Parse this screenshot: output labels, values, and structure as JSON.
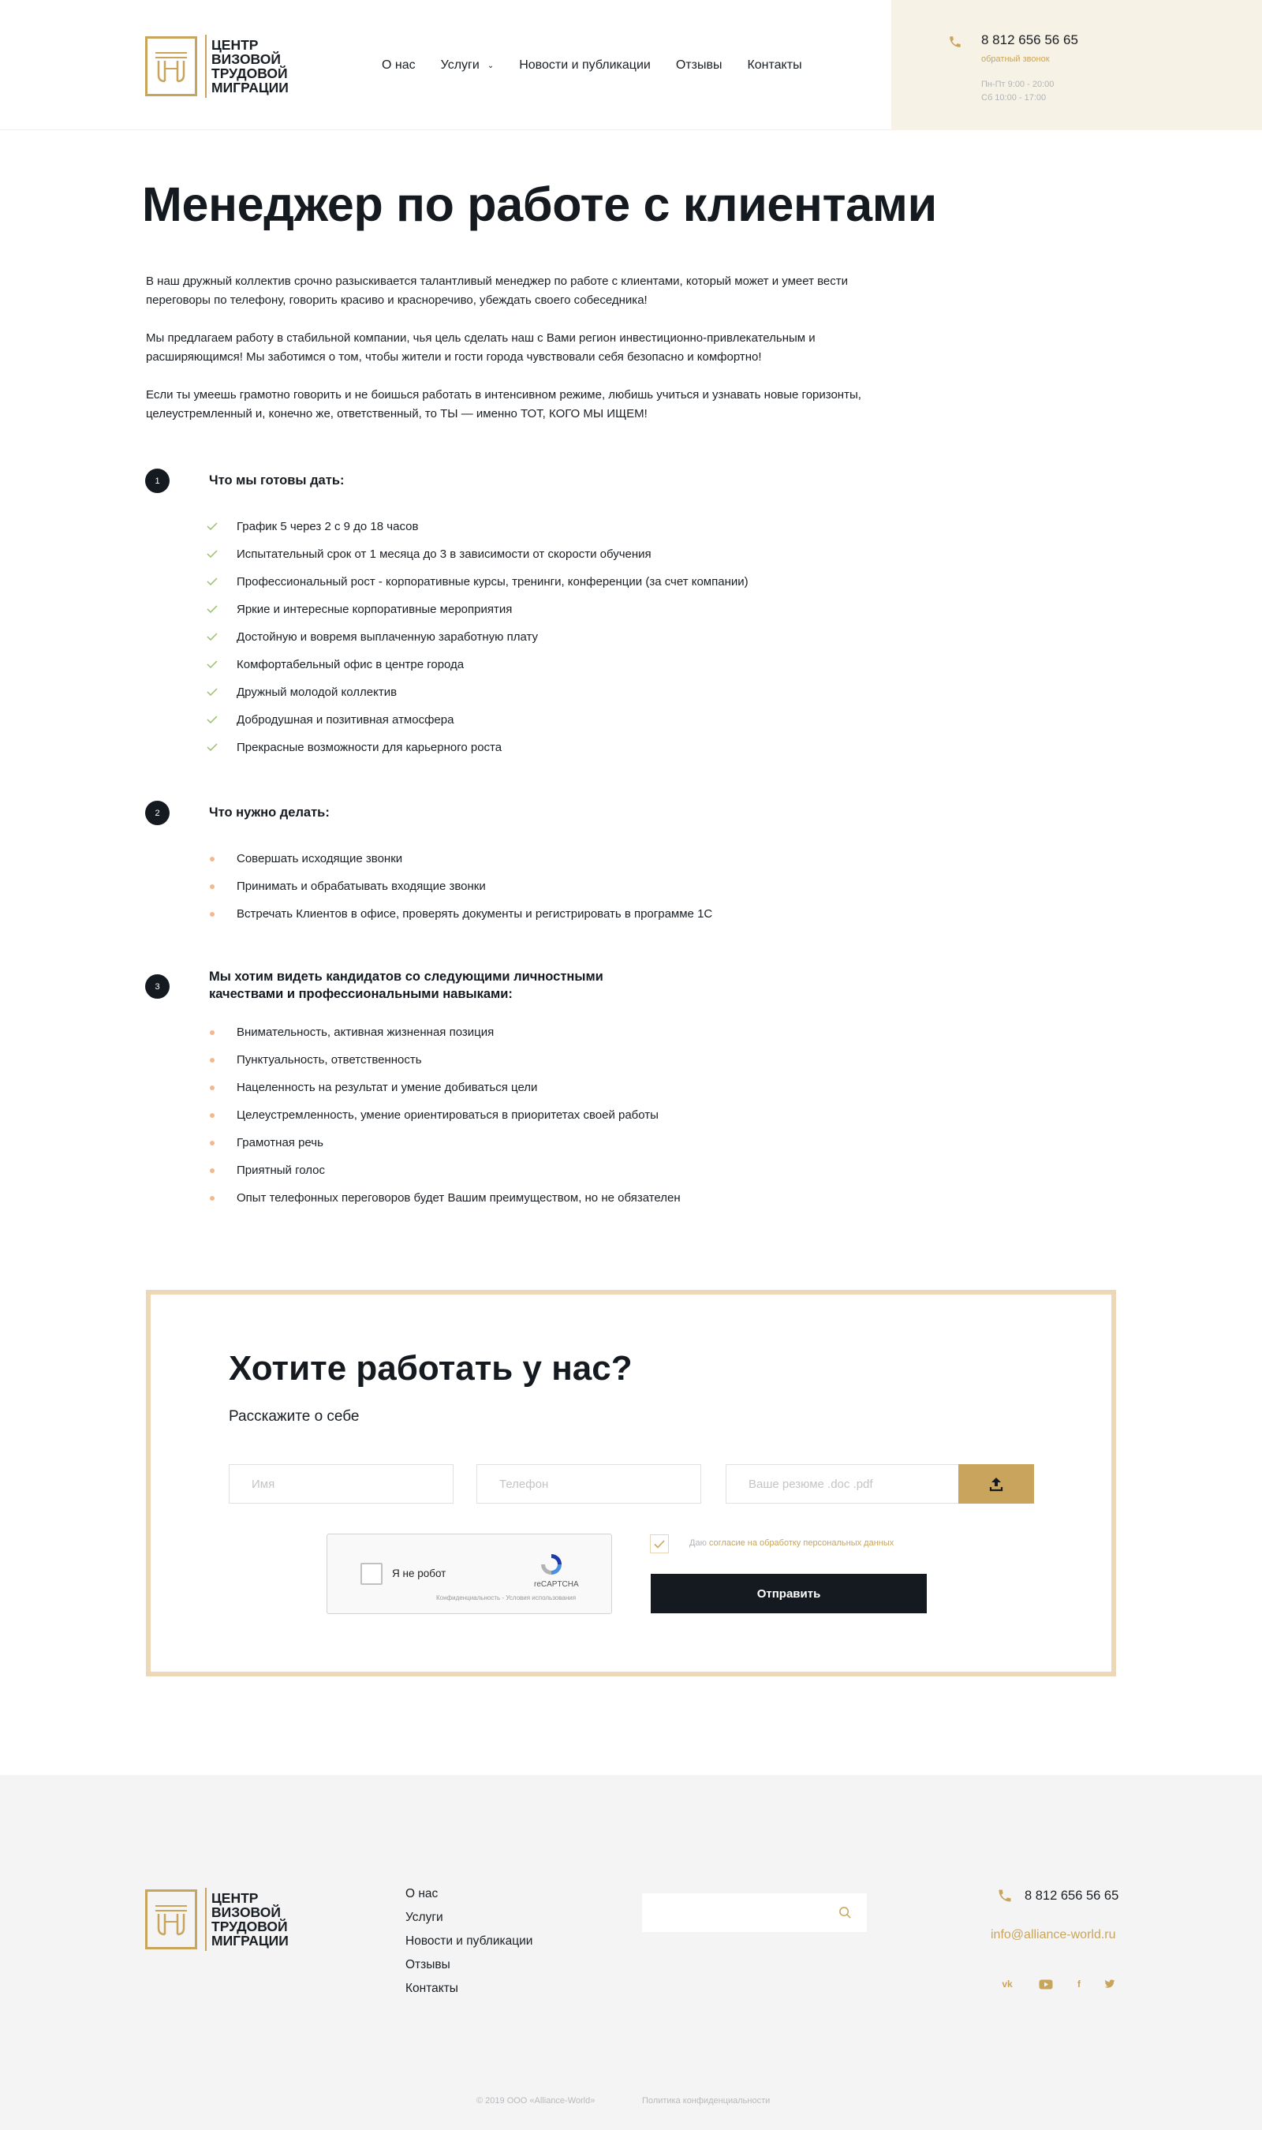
{
  "header": {
    "logo_lines": [
      "ЦЕНТР",
      "ВИЗОВОЙ",
      "ТРУДОВОЙ",
      "МИГРАЦИИ"
    ],
    "nav": [
      {
        "label": "О нас"
      },
      {
        "label": "Услуги",
        "has_dropdown": true
      },
      {
        "label": "Новости и публикации"
      },
      {
        "label": "Отзывы"
      },
      {
        "label": "Контакты"
      }
    ],
    "phone": "8 812 656 56 65",
    "callback": "обратный звонок",
    "hours_weekdays": "Пн-Пт 9:00 - 20:00",
    "hours_saturday": "Сб 10:00 - 17:00"
  },
  "main": {
    "title": "Менеджер по работе с клиентами",
    "intro": [
      "В наш дружный коллектив срочно разыскивается талантливый менеджер по работе с клиентами, который может и умеет вести переговоры по телефону, говорить красиво и красноречиво, убеждать своего собеседника!",
      "Мы предлагаем работу в стабильной компании, чья цель сделать наш с Вами регион инвестиционно-привлекательным и расширяющимся! Мы заботимся о том, чтобы жители и гости города чувствовали себя безопасно и комфортно!",
      "Если ты умеешь грамотно говорить и не боишься работать в интенсивном режиме, любишь учиться и узнавать новые горизонты, целеустремленный и, конечно же, ответственный, то ТЫ — именно ТОТ, КОГО МЫ ИЩЕМ!"
    ],
    "sections": [
      {
        "number": "1",
        "title": "Что мы готовы дать:",
        "items": [
          "График 5 через 2 с 9 до 18 часов",
          "Испытательный срок от 1 месяца до 3 в зависимости от скорости обучения",
          "Профессиональный рост - корпоративные курсы, тренинги, конференции (за счет компании)",
          "Яркие и интересные корпоративные мероприятия",
          "Достойную и вовремя выплаченную заработную плату",
          "Комфортабельный офис в центре города",
          "Дружный молодой коллектив",
          "Добродушная и позитивная атмосфера",
          "Прекрасные возможности для карьерного роста"
        ]
      },
      {
        "number": "2",
        "title": "Что нужно делать:",
        "items": [
          "Совершать исходящие звонки",
          "Принимать и обрабатывать входящие звонки",
          "Встречать Клиентов в офисе, проверять документы и регистрировать в программе 1С"
        ]
      },
      {
        "number": "3",
        "title_lines": [
          "Мы хотим видеть кандидатов со следующими личностными",
          "качествами и профессиональными навыками:"
        ],
        "items": [
          "Внимательность, активная жизненная позиция",
          "Пунктуальность, ответственность",
          "Нацеленность на результат и умение добиваться цели",
          "Целеустремленность, умение ориентироваться в приоритетах своей работы",
          "Грамотная речь",
          "Приятный голос",
          "Опыт телефонных переговоров будет Вашим преимуществом, но не обязателен"
        ]
      }
    ]
  },
  "form": {
    "title": "Хотите работать у нас?",
    "subtitle": "Расскажите о себе",
    "name_placeholder": "Имя",
    "phone_placeholder": "Телефон",
    "resume_placeholder": "Ваше резюме .doc .pdf",
    "captcha_label": "Я не робот",
    "captcha_brand": "reCAPTCHA",
    "captcha_links": "Конфиденциальность - Условия использования",
    "consent_prefix": "Даю",
    "consent_link": "согласие на обработку персональных данных",
    "consent_checked": true,
    "submit": "Отправить"
  },
  "footer": {
    "logo_lines": [
      "ЦЕНТР",
      "ВИЗОВОЙ",
      "ТРУДОВОЙ",
      "МИГРАЦИИ"
    ],
    "nav": [
      "О нас",
      "Услуги",
      "Новости и публикации",
      "Отзывы",
      "Контакты"
    ],
    "phone": "8 812 656 56 65",
    "email": "info@alliance-world.ru",
    "social": [
      "vk-icon",
      "youtube-icon",
      "facebook-icon",
      "twitter-icon"
    ],
    "copyright": "© 2019 ООО «Alliance-World»",
    "policy": "Политика конфиденциальности"
  },
  "colors": {
    "accent": "#c9a45c",
    "dark": "#141a20",
    "contact_bg": "#f7f2e6",
    "bullet": "#f2b88e",
    "form_border": "#ecd8b6"
  }
}
